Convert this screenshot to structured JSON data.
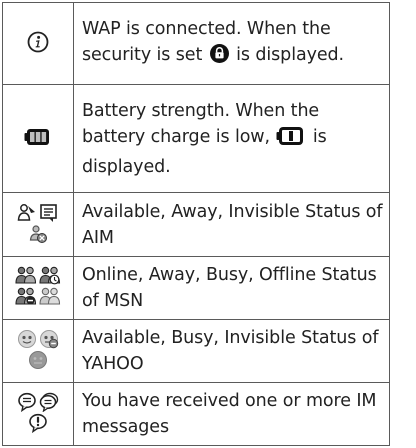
{
  "rows": [
    {
      "icon": "wap-info-icon",
      "text_before": "WAP is connected. When the security is set",
      "inline_icon": "lock-icon",
      "text_after": "is displayed."
    },
    {
      "icon": "battery-full-icon",
      "text_before": "Battery strength. When the battery charge is low,",
      "inline_icon": "battery-low-icon",
      "text_after": "is displayed."
    },
    {
      "icons": [
        "aim-available-icon",
        "aim-away-icon",
        "aim-invisible-icon"
      ],
      "text": "Available, Away, Invisible Status of AIM"
    },
    {
      "icons": [
        "msn-online-icon",
        "msn-away-icon",
        "msn-busy-icon",
        "msn-offline-icon"
      ],
      "text": "Online, Away, Busy, Offline Status of MSN"
    },
    {
      "icons": [
        "yahoo-available-icon",
        "yahoo-busy-icon",
        "yahoo-invisible-icon"
      ],
      "text": "Available, Busy, Invisible Status of YAHOO"
    },
    {
      "icons": [
        "im-message-icon",
        "im-messages-icon",
        "im-message-alert-icon"
      ],
      "text": "You have received one or more IM messages"
    }
  ]
}
